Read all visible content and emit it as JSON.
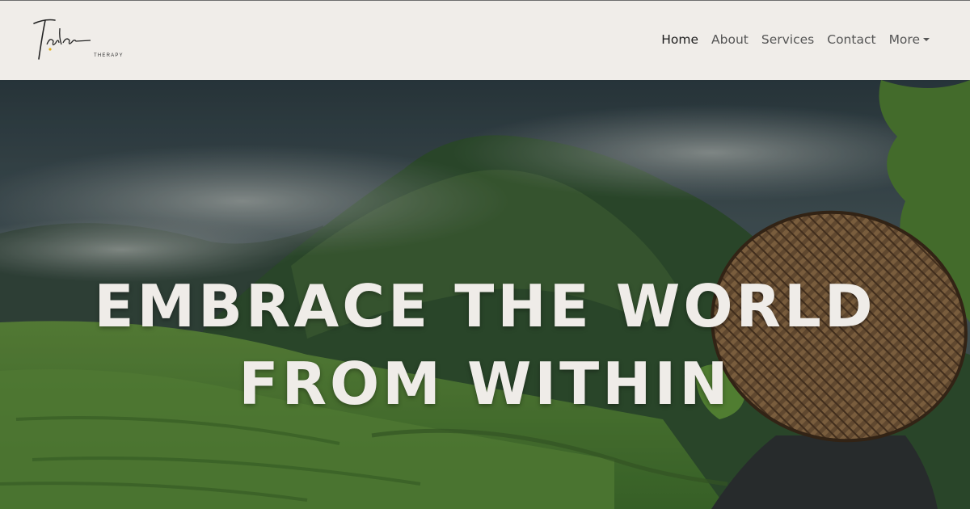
{
  "brand": {
    "script_name": "Tala",
    "subtitle": "THERAPY"
  },
  "nav": {
    "items": [
      {
        "label": "Home",
        "active": true
      },
      {
        "label": "About",
        "active": false
      },
      {
        "label": "Services",
        "active": false
      },
      {
        "label": "Contact",
        "active": false
      },
      {
        "label": "More",
        "active": false,
        "dropdown": true
      }
    ]
  },
  "hero": {
    "title": "EMBRACE THE WORLD FROM WITHIN"
  },
  "colors": {
    "nav_bg": "#f0ede9",
    "nav_text": "#555555",
    "nav_active": "#1e1e1e",
    "hero_text": "#efece8",
    "logo_accent": "#e0b020"
  }
}
